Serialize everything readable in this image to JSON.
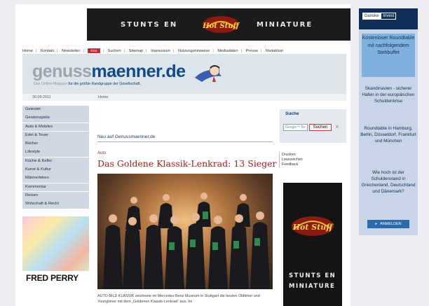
{
  "top_banner": {
    "left_text": "STUNTS EN",
    "right_text": "MINIATURE",
    "logo_text": "Hot Stuff"
  },
  "nav": {
    "items": [
      "Home",
      "Kontakt",
      "Newsletter",
      "Suchen",
      "Sitemap",
      "Impressum",
      "Nutzungshinweise",
      "Mediadaten",
      "Presse",
      "Redaktion"
    ],
    "badge": "RSS"
  },
  "header": {
    "brand_part1": "genuss",
    "brand_part2": "maenner",
    "brand_part3": ".de",
    "tagline_muted": "Das Online-Magazin",
    "tagline_bold": "für die größte Randgruppe der Gesellschaft."
  },
  "datebar": {
    "date": "30.09.2011",
    "breadcrumb": "Home"
  },
  "sidebar": {
    "items": [
      "Getestet",
      "Gewinnspiele",
      "Auto & Mobiles",
      "Edel & Teuer",
      "Bücher",
      "Lifestyle",
      "Küche & Keller",
      "Kunst & Kultur",
      "Männerleben",
      "Kommentar",
      "Reisen",
      "Wirtschaft & Recht"
    ]
  },
  "ad_left": {
    "brand": "FRED PERRY"
  },
  "article": {
    "section_heading": "Neu auf Genussmaenner.de",
    "category": "Auto",
    "title": "Das Goldene Klassik-Lenkrad: 13 Sieger",
    "tools": [
      "Drucken",
      "Lesezeichen",
      "Feedback"
    ],
    "caption": "AUTO BILD KLASSIK zeichnete im Mercedes-Benz Museum in Stuttgart die besten Oldtimer und Youngtimer mit dem „Goldenen Klassik-Lenkrad“ aus. Im"
  },
  "search": {
    "label": "Suche",
    "placeholder": "Google™ Be",
    "button": "Suchen",
    "clear": "×"
  },
  "skyscraper": {
    "logo_text": "Hot Stuff",
    "line1": "STUNTS EN",
    "line2": "MINIATURE"
  },
  "right_ad": {
    "logo_a": "Danske",
    "logo_b": "Invest",
    "promo": "Kostenloser Roundtable mit nachfolgendem Stehbuffet",
    "text1": "Skandinavien - sicherer Hafen in der europäischen Schuldenkrise",
    "text2": "Roundtable in Hamburg, Berlin, Düsseldorf, Frankfurt und München",
    "text3": "Wie hoch ist der Schuldenstand in Griechenland, Deutschland und Dänemark?",
    "button": "ANMELDEN"
  }
}
